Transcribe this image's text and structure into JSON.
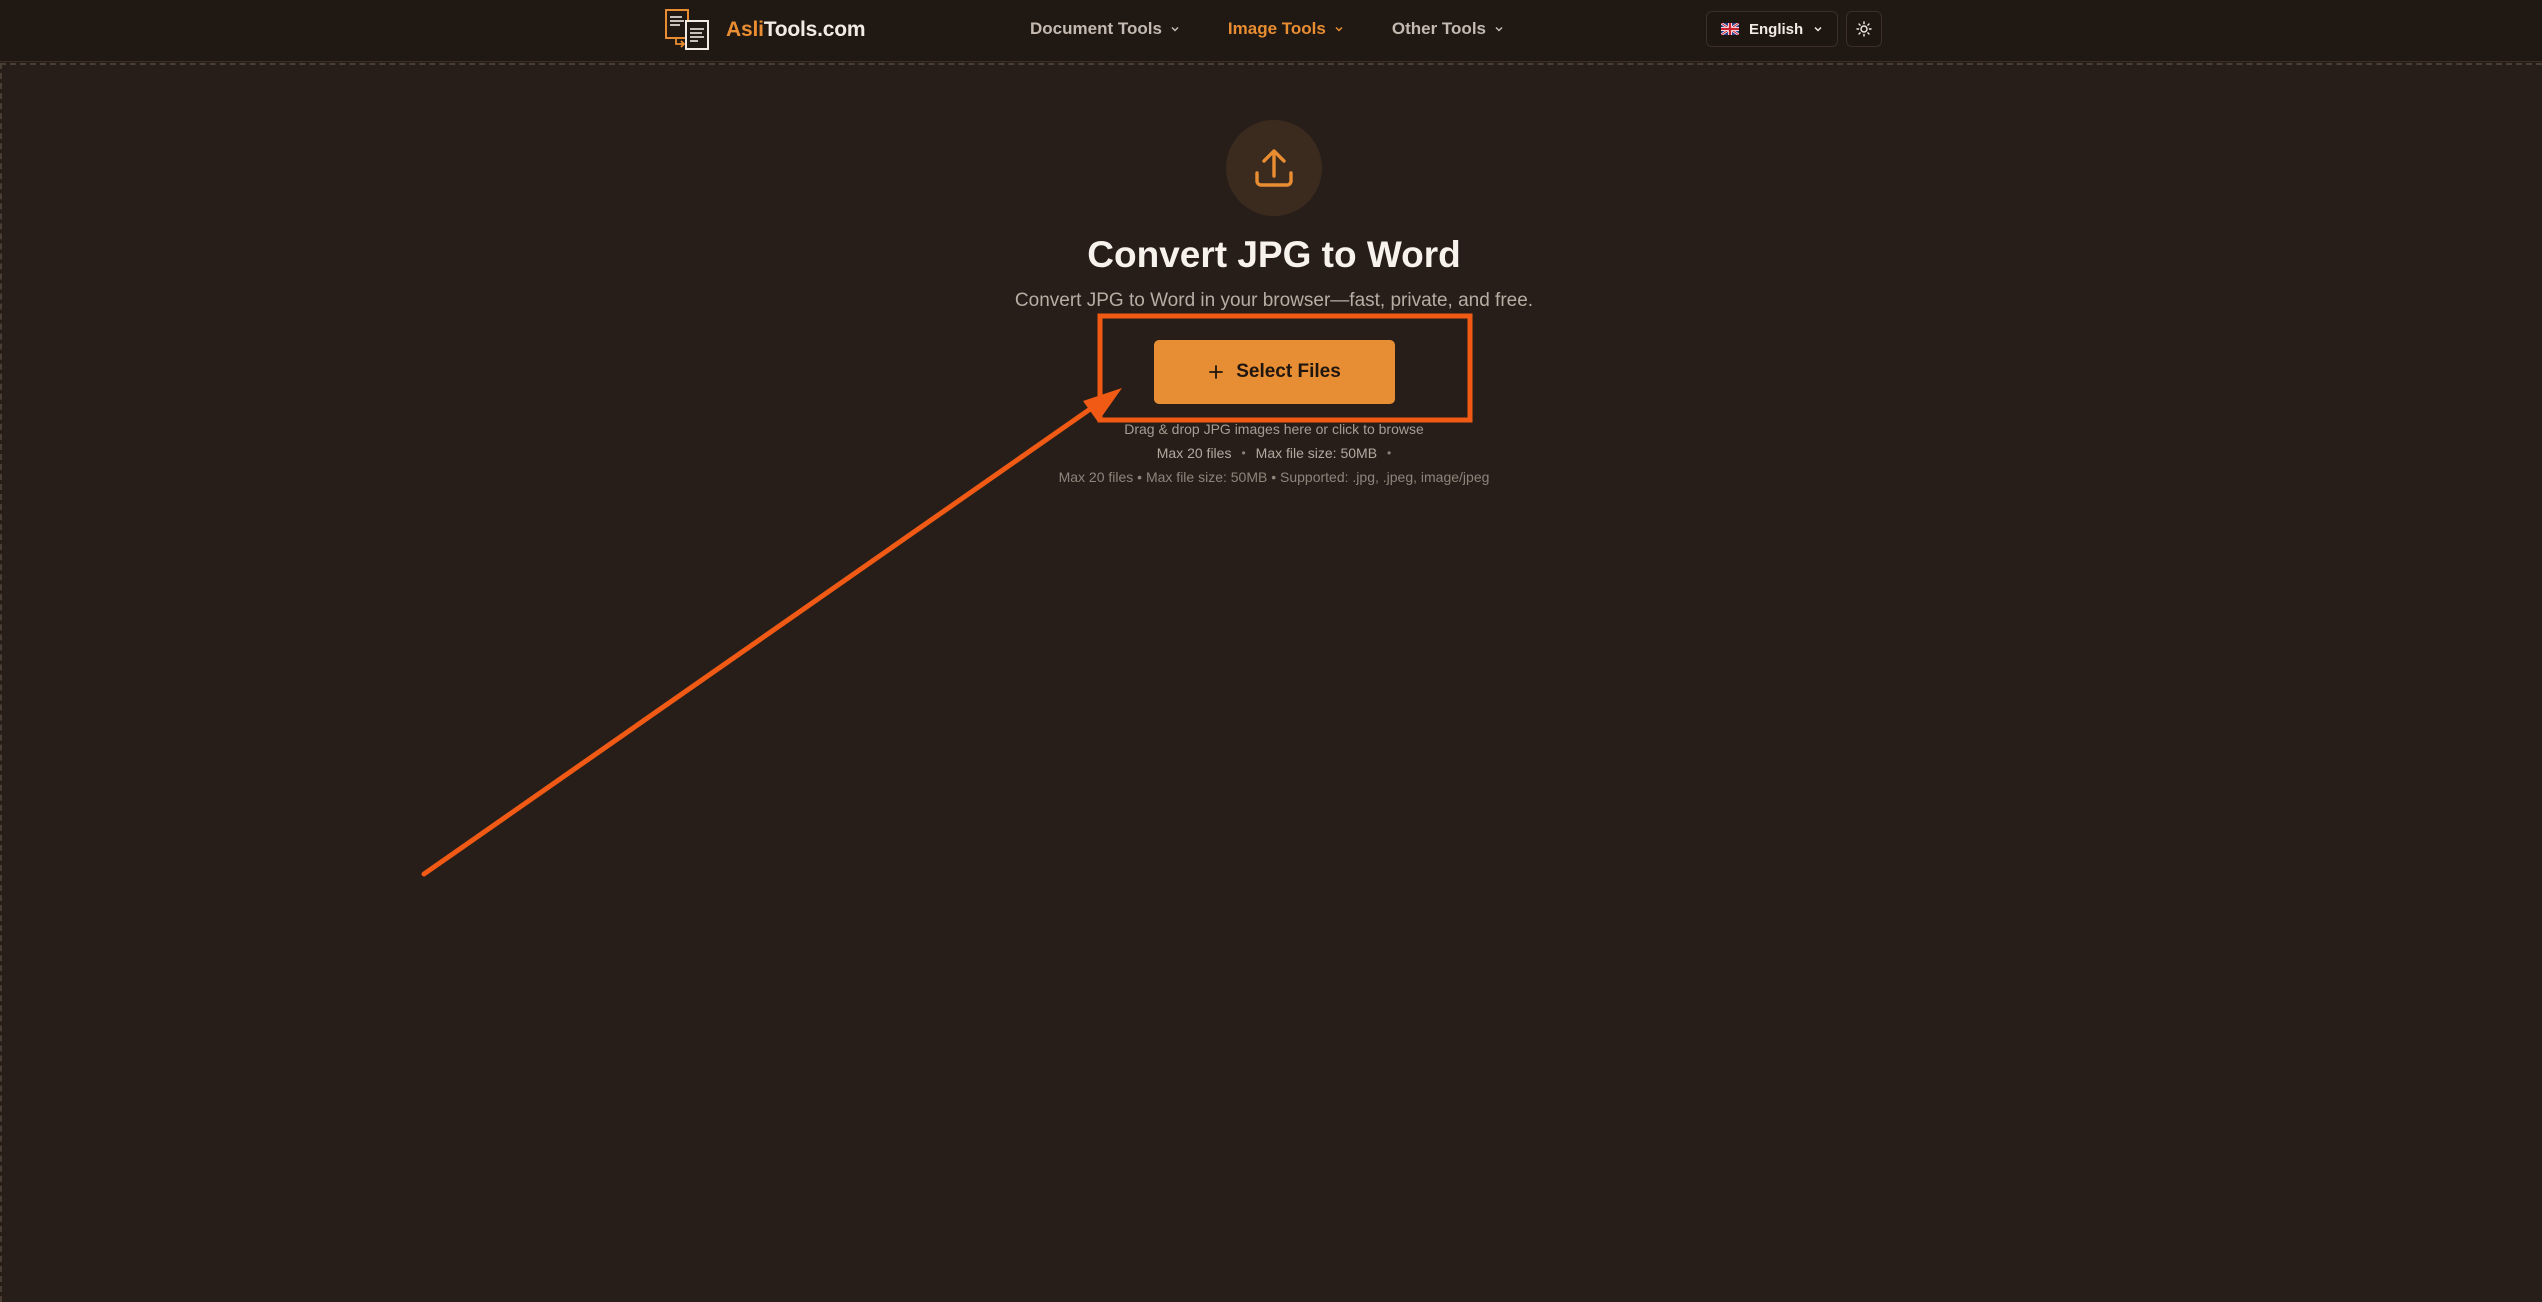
{
  "header": {
    "logo": {
      "accent": "Asli",
      "rest": "Tools.com"
    },
    "nav": [
      {
        "label": "Document Tools"
      },
      {
        "label": "Image Tools"
      },
      {
        "label": "Other Tools"
      }
    ],
    "language": "English",
    "theme_icon": "sun-icon"
  },
  "main": {
    "icon": "upload-icon",
    "title": "Convert JPG to Word",
    "subtitle": "Convert JPG to Word in your browser—fast, private, and free.",
    "button_label": "Select Files",
    "hint": "Drag & drop JPG images here or click to browse",
    "limits": [
      "Max 20 files",
      "Max file size: 50MB"
    ],
    "supported": "Max 20 files • Max file size: 50MB • Supported: .jpg, .jpeg, image/jpeg"
  },
  "colors": {
    "accent": "#e98d32",
    "background": "#271e1a",
    "annotation": "#f05a14"
  }
}
